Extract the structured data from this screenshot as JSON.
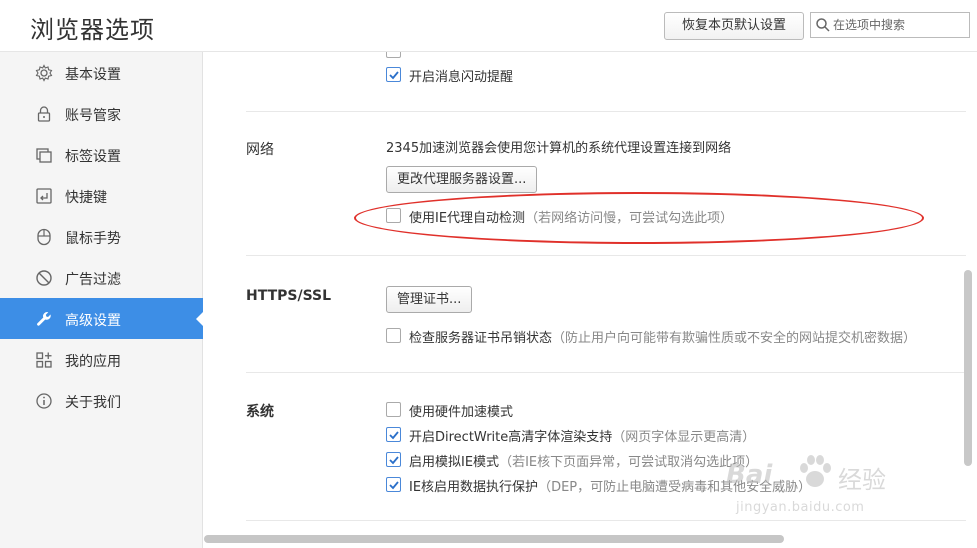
{
  "header": {
    "title": "浏览器选项",
    "restore_button": "恢复本页默认设置",
    "search_placeholder": "在选项中搜索"
  },
  "sidebar": {
    "items": [
      {
        "label": "基本设置",
        "icon": "gear-icon"
      },
      {
        "label": "账号管家",
        "icon": "lock-icon"
      },
      {
        "label": "标签设置",
        "icon": "tabs-icon"
      },
      {
        "label": "快捷键",
        "icon": "keyboard-icon"
      },
      {
        "label": "鼠标手势",
        "icon": "mouse-icon"
      },
      {
        "label": "广告过滤",
        "icon": "block-icon"
      },
      {
        "label": "高级设置",
        "icon": "wrench-icon",
        "active": true
      },
      {
        "label": "我的应用",
        "icon": "apps-icon"
      },
      {
        "label": "关于我们",
        "icon": "info-icon"
      }
    ]
  },
  "content": {
    "top": {
      "flash_reminder": {
        "label": "开启消息闪动提醒",
        "checked": true
      }
    },
    "network": {
      "title": "网络",
      "description": "2345加速浏览器会使用您计算机的系统代理设置连接到网络",
      "proxy_button": "更改代理服务器设置...",
      "ie_proxy": {
        "label": "使用IE代理自动检测",
        "hint": "（若网络访问慢，可尝试勾选此项）",
        "checked": false
      }
    },
    "https": {
      "title": "HTTPS/SSL",
      "cert_button": "管理证书...",
      "revocation": {
        "label": "检查服务器证书吊销状态",
        "hint": "（防止用户向可能带有欺骗性质或不安全的网站提交机密数据）",
        "checked": false
      }
    },
    "system": {
      "title": "系统",
      "hw_accel": {
        "label": "使用硬件加速模式",
        "hint": "",
        "checked": false
      },
      "directwrite": {
        "label": "开启DirectWrite高清字体渲染支持",
        "hint": "（网页字体显示更高清）",
        "checked": true
      },
      "ie_mode": {
        "label": "启用模拟IE模式",
        "hint": "（若IE核下页面异常，可尝试取消勾选此项）",
        "checked": true
      },
      "dep": {
        "label": "IE核启用数据执行保护",
        "hint": "（DEP，可防止电脑遭受病毒和其他安全威胁）",
        "checked": true
      }
    }
  },
  "watermark": {
    "logo_left": "Bai",
    "logo_right": "经验",
    "url": "jingyan.baidu.com"
  },
  "colors": {
    "accent": "#3d8ee6",
    "annotation_red": "#e0302a",
    "checkbox_checked": "#4a88d9"
  }
}
